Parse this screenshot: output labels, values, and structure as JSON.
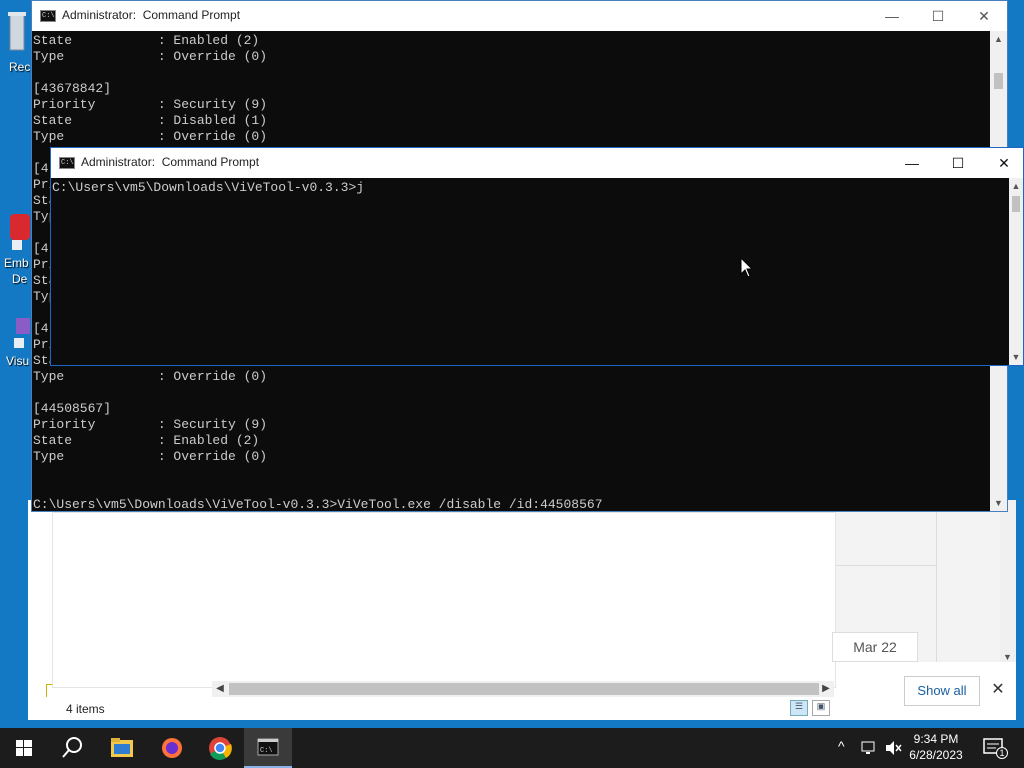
{
  "desktop": {
    "icons": [
      {
        "label": "Rec"
      },
      {
        "label": "Emb"
      },
      {
        "label": "De"
      },
      {
        "label": "Visu"
      }
    ]
  },
  "cmd_back": {
    "title": "Administrator:  Command Prompt",
    "lines": [
      "State           : Enabled (2)",
      "Type            : Override (0)",
      "",
      "[43678842]",
      "Priority        : Security (9)",
      "State           : Disabled (1)",
      "Type            : Override (0)",
      "",
      "[4",
      "Pri",
      "Sta",
      "Typ",
      "",
      "[4",
      "Pri",
      "Sta",
      "Typ",
      "",
      "[4",
      "Pri",
      "Sta",
      "Type            : Override (0)",
      "",
      "[44508567]",
      "Priority        : Security (9)",
      "State           : Enabled (2)",
      "Type            : Override (0)",
      "",
      "",
      "C:\\Users\\vm5\\Downloads\\ViVeTool-v0.3.3>ViVeTool.exe /disable /id:44508567"
    ]
  },
  "cmd_front": {
    "title": "Administrator:  Command Prompt",
    "lines": [
      "C:\\Users\\vm5\\Downloads\\ViVeTool-v0.3.3>j"
    ]
  },
  "explorer": {
    "status_count": "4 items",
    "date_chip": "Mar 22"
  },
  "notification": {
    "show_all": "Show all",
    "close": "✕"
  },
  "taskbar": {
    "time": "9:34 PM",
    "date": "6/28/2023",
    "notification_count": "1",
    "accent": "#8ab4e8"
  },
  "colors": {
    "desktop": "#1479c4",
    "console_bg": "#0c0c0c",
    "console_fg": "#cccccc"
  }
}
